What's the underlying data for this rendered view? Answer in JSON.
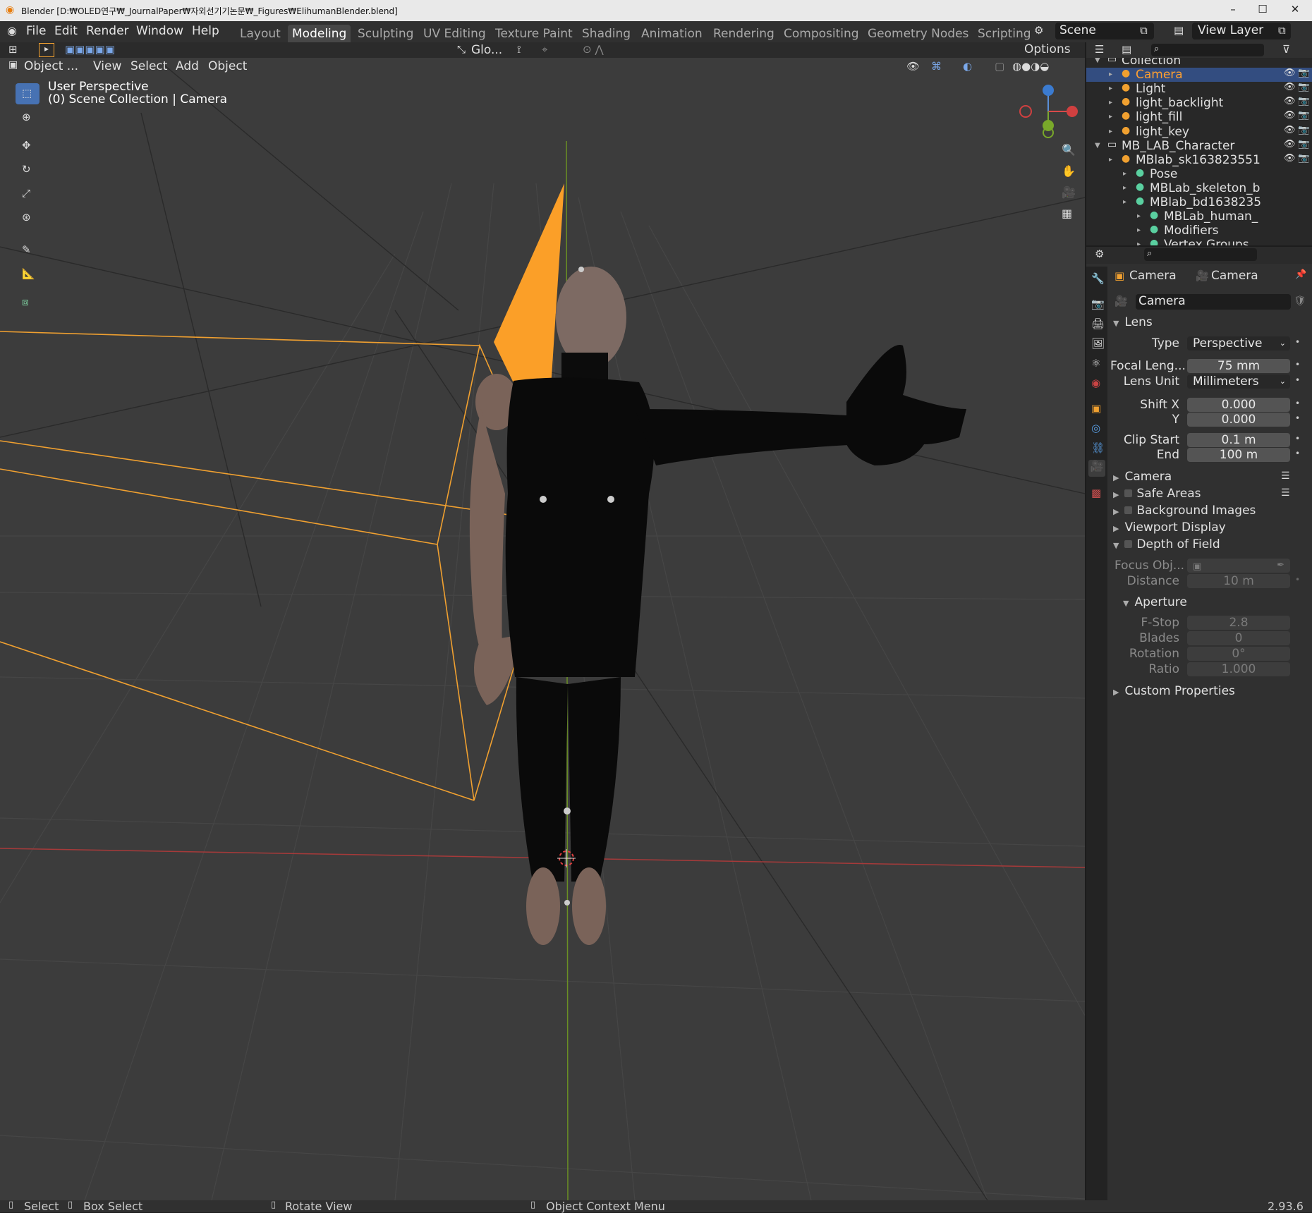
{
  "window": {
    "title": "Blender [D:₩OLED연구₩_JournalPaper₩자외선기기논문₩_Figures₩ElihumanBlender.blend]",
    "minimize": "–",
    "maximize": "☐",
    "close": "✕"
  },
  "menu": [
    "File",
    "Edit",
    "Render",
    "Window",
    "Help"
  ],
  "workspaces": [
    "Layout",
    "Modeling",
    "Sculpting",
    "UV Editing",
    "Texture Paint",
    "Shading",
    "Animation",
    "Rendering",
    "Compositing",
    "Geometry Nodes",
    "Scripting"
  ],
  "active_workspace": "Modeling",
  "scene": "Scene",
  "view_layer": "View Layer",
  "viewport": {
    "mode": "Object ...",
    "menus": [
      "View",
      "Select",
      "Add",
      "Object"
    ],
    "transform_orientation": "Glo...",
    "options": "Options",
    "perspective": "User Perspective",
    "context": "(0) Scene Collection | Camera"
  },
  "outliner": {
    "rows": [
      {
        "label": "Collection",
        "indent": 0
      },
      {
        "label": "Camera",
        "indent": 1,
        "selected": true
      },
      {
        "label": "Light",
        "indent": 1
      },
      {
        "label": "light_backlight",
        "indent": 1
      },
      {
        "label": "light_fill",
        "indent": 1
      },
      {
        "label": "light_key",
        "indent": 1
      },
      {
        "label": "MB_LAB_Character",
        "indent": 0
      },
      {
        "label": "MBlab_sk163823551",
        "indent": 1
      },
      {
        "label": "Pose",
        "indent": 2
      },
      {
        "label": "MBLab_skeleton_b",
        "indent": 2
      },
      {
        "label": "MBlab_bd1638235",
        "indent": 2
      },
      {
        "label": "MBLab_human_",
        "indent": 3
      },
      {
        "label": "Modifiers",
        "indent": 3
      },
      {
        "label": "Vertex Groups",
        "indent": 3
      }
    ]
  },
  "properties": {
    "breadcrumb_object": "Camera",
    "breadcrumb_data": "Camera",
    "datablock": "Camera",
    "lens": {
      "title": "Lens",
      "type_label": "Type",
      "type_value": "Perspective",
      "focal_label": "Focal Leng...",
      "focal_value": "75 mm",
      "unit_label": "Lens Unit",
      "unit_value": "Millimeters",
      "shiftx_label": "Shift X",
      "shiftx_value": "0.000",
      "shifty_label": "Y",
      "shifty_value": "0.000",
      "clipstart_label": "Clip Start",
      "clipstart_value": "0.1 m",
      "clipend_label": "End",
      "clipend_value": "100 m"
    },
    "sections": [
      "Camera",
      "Safe Areas",
      "Background Images",
      "Viewport Display",
      "Depth of Field"
    ],
    "dof": {
      "focus_label": "Focus Obj...",
      "distance_label": "Distance",
      "distance_value": "10 m",
      "aperture": "Aperture",
      "fstop_label": "F-Stop",
      "fstop_value": "2.8",
      "blades_label": "Blades",
      "blades_value": "0",
      "rotation_label": "Rotation",
      "rotation_value": "0°",
      "ratio_label": "Ratio",
      "ratio_value": "1.000"
    },
    "custom": "Custom Properties"
  },
  "statusbar": {
    "select": "Select",
    "box_select": "Box Select",
    "rotate": "Rotate View",
    "context_menu": "Object Context Menu",
    "version": "2.93.6"
  }
}
